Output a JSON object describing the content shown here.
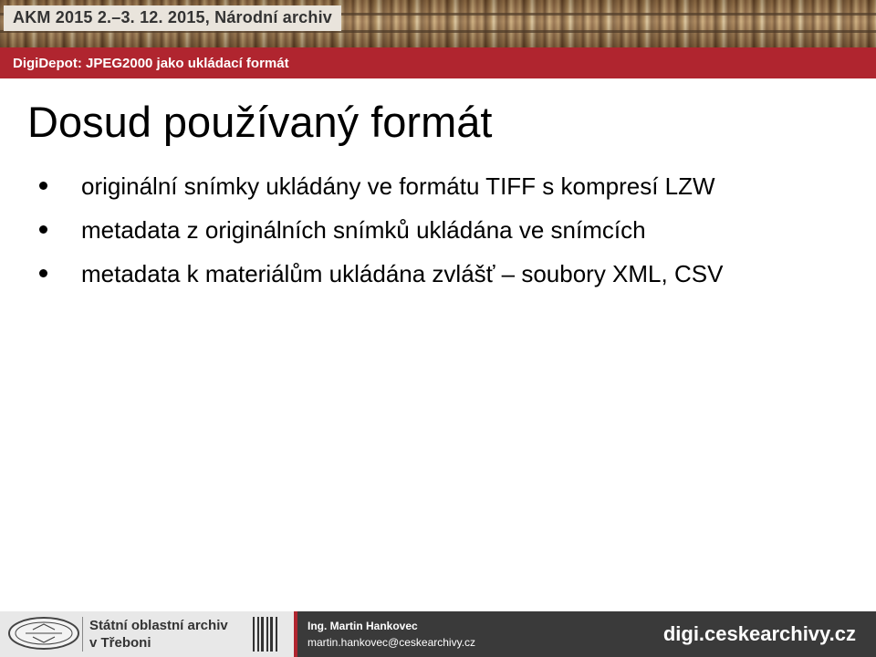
{
  "header": {
    "conference_title": "AKM 2015 2.–3. 12. 2015, Národní archiv",
    "subtitle": "DigiDepot: JPEG2000 jako ukládací formát"
  },
  "slide": {
    "title": "Dosud používaný formát",
    "bullets": [
      "originální snímky ukládány ve formátu TIFF s kompresí LZW",
      "metadata z originálních snímků ukládána ve snímcích",
      "metadata k materiálům ukládána zvlášť – soubory XML, CSV"
    ]
  },
  "footer": {
    "seal_text_top": "ARCHIVUM",
    "seal_text_bottom": "TŘEBONENSE",
    "archive_name_line1": "Státní oblastní archiv",
    "archive_name_line2": "v Třeboni",
    "person_name": "Ing. Martin Hankovec",
    "person_email": "martin.hankovec@ceskearchivy.cz",
    "site_url": "digi.ceskearchivy.cz"
  },
  "colors": {
    "accent_red": "#b0252f",
    "footer_dark": "#3a3a3a"
  }
}
